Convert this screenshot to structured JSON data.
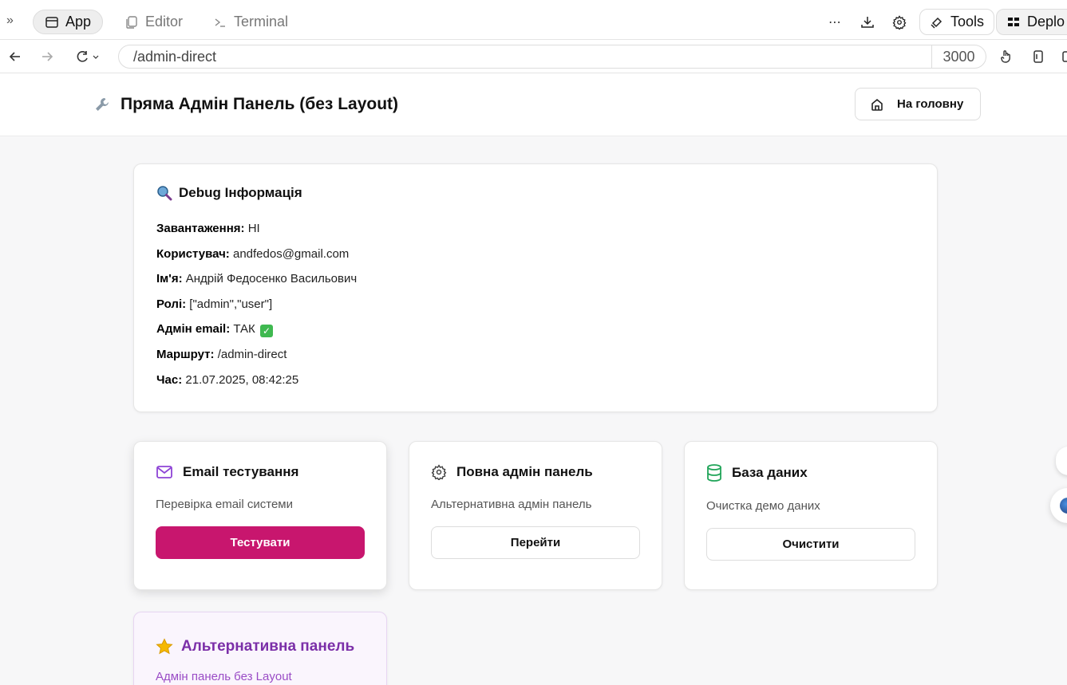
{
  "browser": {
    "tabs": [
      {
        "label": "App",
        "active": true
      },
      {
        "label": "Editor",
        "active": false
      },
      {
        "label": "Terminal",
        "active": false
      }
    ],
    "tools_label": "Tools",
    "deploy_label": "Deplo",
    "url": "/admin-direct",
    "port": "3000"
  },
  "header": {
    "title": "Пряма Адмін Панель (без Layout)",
    "home_button": "На головну"
  },
  "debug": {
    "title": "Debug Інформація",
    "rows": [
      {
        "label": "Завантаження:",
        "value": "НІ"
      },
      {
        "label": "Користувач:",
        "value": "andfedos@gmail.com"
      },
      {
        "label": "Ім'я:",
        "value": "Андрій Федосенко Васильович"
      },
      {
        "label": "Ролі:",
        "value": "[\"admin\",\"user\"]"
      },
      {
        "label": "Адмін email:",
        "value": "ТАК"
      },
      {
        "label": "Маршрут:",
        "value": "/admin-direct"
      },
      {
        "label": "Час:",
        "value": "21.07.2025, 08:42:25"
      }
    ]
  },
  "cards": [
    {
      "title": "Email тестування",
      "description": "Перевірка email системи",
      "button": "Тестувати"
    },
    {
      "title": "Повна адмін панель",
      "description": "Альтернативна адмін панель",
      "button": "Перейти"
    },
    {
      "title": "База даних",
      "description": "Очистка демо даних",
      "button": "Очистити"
    }
  ],
  "alt_card": {
    "title": "Альтернативна панель",
    "description": "Адмін панель без Layout"
  },
  "colors": {
    "primary_button": "#c8166e",
    "email_icon": "#8e44d6",
    "db_icon": "#22a55a",
    "alt_title": "#7b2fa8"
  }
}
